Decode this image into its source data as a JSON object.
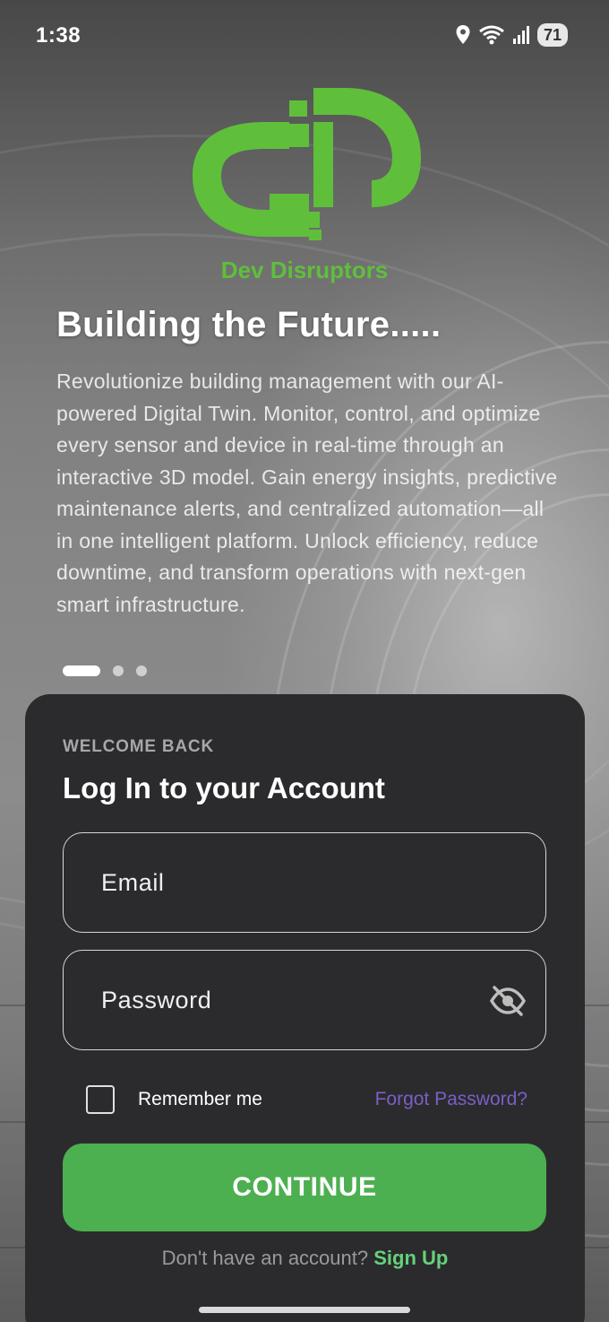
{
  "status_bar": {
    "time": "1:38",
    "battery": "71",
    "icons": [
      "location-icon",
      "wifi-icon",
      "signal-icon"
    ]
  },
  "brand": {
    "name": "Dev Disruptors",
    "color": "#5fbf3b"
  },
  "hero": {
    "headline": "Building the Future.....",
    "description": "Revolutionize building management with our AI-powered Digital Twin. Monitor, control, and optimize every sensor and device in real-time through an interactive 3D model. Gain energy insights, predictive maintenance alerts, and centralized automation—all in one intelligent platform. Unlock efficiency, reduce downtime, and transform operations with next-gen smart infrastructure.",
    "carousel": {
      "total": 3,
      "active": 1
    }
  },
  "login": {
    "eyebrow": "WELCOME BACK",
    "title": "Log In to your Account",
    "email_placeholder": "Email",
    "password_placeholder": "Password",
    "remember_label": "Remember me",
    "remember_checked": false,
    "forgot_label": "Forgot Password?",
    "continue_label": "CONTINUE",
    "signup_prompt": "Don't have an account?",
    "signup_link": "Sign Up"
  },
  "colors": {
    "accent": "#4caf50",
    "card": "#2b2b2e",
    "link_purple": "#7d5ec4",
    "link_green": "#66d17a"
  }
}
